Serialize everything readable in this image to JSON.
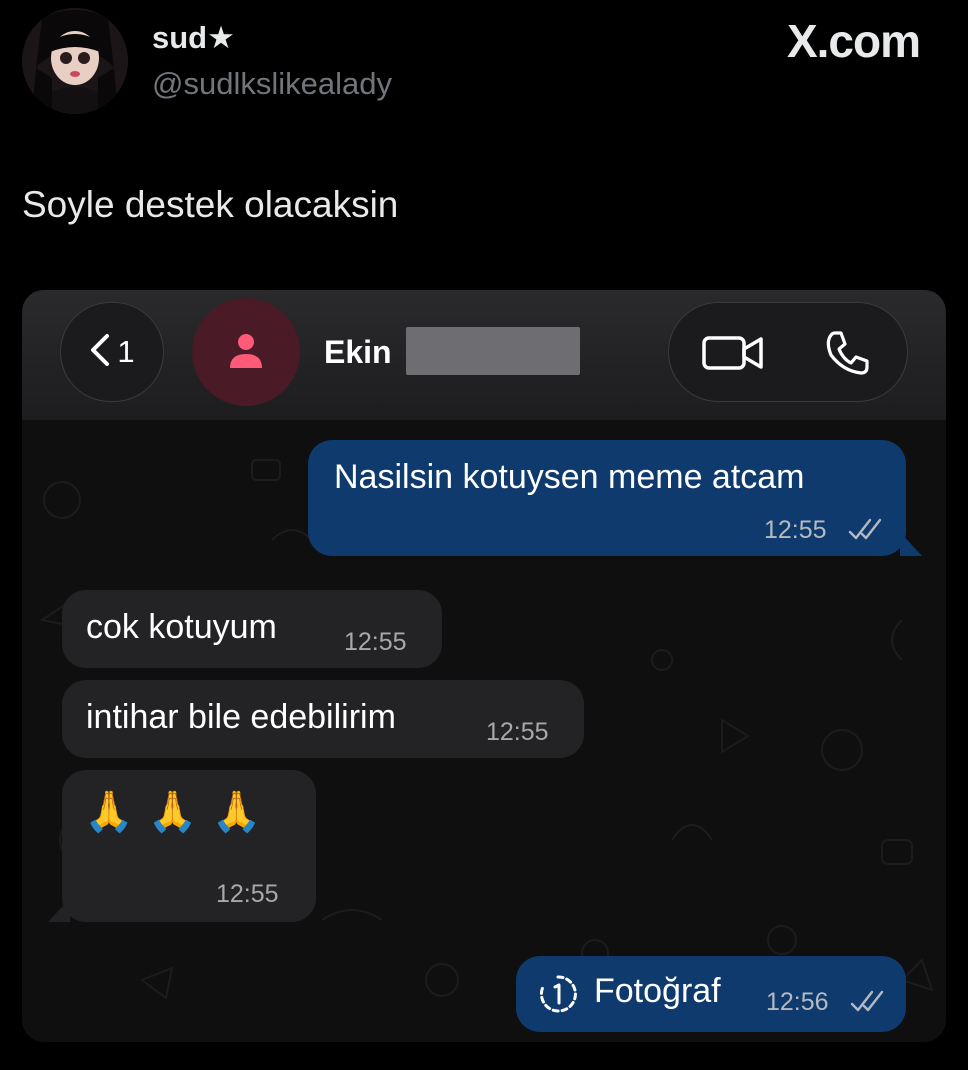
{
  "tweet": {
    "display_name": "sud★",
    "handle": "@sudlkslikealady",
    "brand": "X.com",
    "text": "Soyle destek olacaksin"
  },
  "chat": {
    "back_count": "1",
    "contact_name": "Ekin",
    "messages": [
      {
        "direction": "outgoing",
        "text": "Nasilsin kotuysen meme atcam",
        "time": "12:55",
        "read": true
      },
      {
        "direction": "incoming",
        "text": "cok kotuyum",
        "time": "12:55"
      },
      {
        "direction": "incoming",
        "text": "intihar bile edebilirim",
        "time": "12:55"
      },
      {
        "direction": "incoming",
        "text": "🙏🙏🙏",
        "time": "12:55"
      },
      {
        "direction": "outgoing",
        "text": "Fotoğraf",
        "time": "12:56",
        "read": true,
        "view_once": true
      }
    ]
  },
  "colors": {
    "background": "#000000",
    "outgoing_bubble": "#0f3a6e",
    "incoming_bubble": "#232325",
    "contact_avatar_bg": "#4a1a26",
    "contact_avatar_icon": "#ff5a78"
  }
}
